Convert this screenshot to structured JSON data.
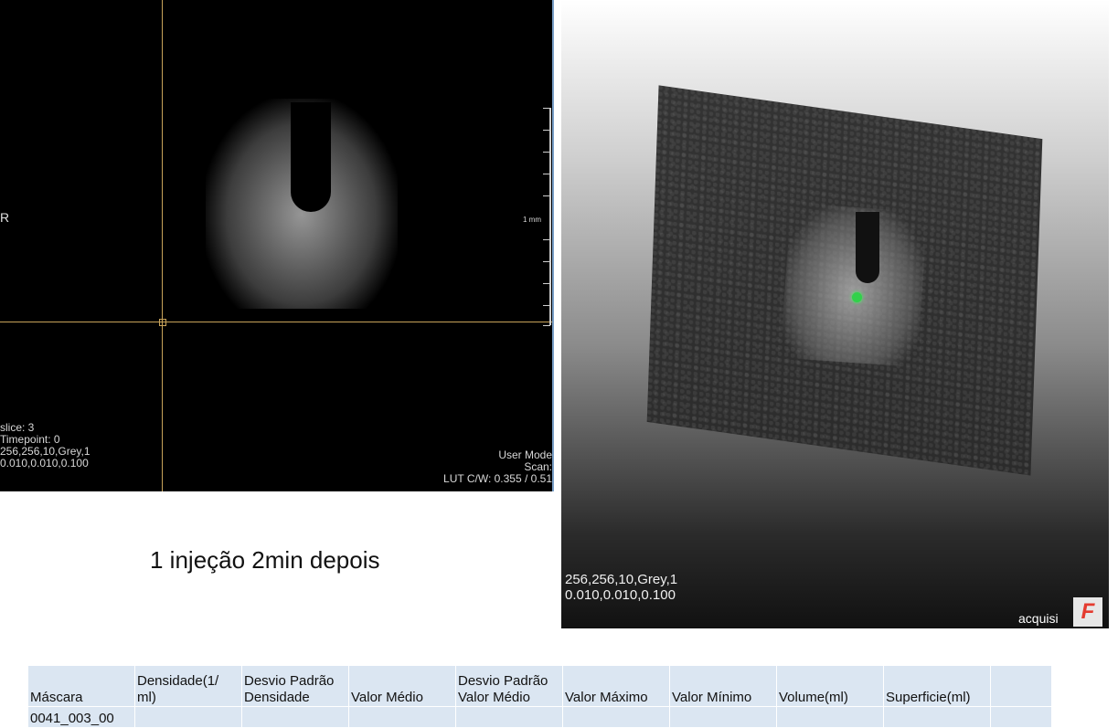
{
  "viewer2d": {
    "orientation_label": "R",
    "overlay_left": {
      "slice": "slice: 3",
      "timepoint": "Timepoint: 0",
      "dims": "256,256,10,Grey,1",
      "spacing": "0.010,0.010,0.100"
    },
    "overlay_right": {
      "mode": "User Mode",
      "scan": "Scan:",
      "lut": "LUT C/W: 0.355 / 0.51"
    },
    "scale_label": "1 mm"
  },
  "viewer3d": {
    "dims": "256,256,10,Grey,1",
    "spacing": "0.010,0.010,0.100",
    "acq_text": "acquisi",
    "logo_letter": "F",
    "marker_color": "#31d14a"
  },
  "caption": "1 injeção 2min depois",
  "table": {
    "headers": [
      "Máscara",
      "Densidade(1/ ml)",
      "Desvio Padrão Densidade",
      "Valor Médio",
      "Desvio Padrão Valor Médio",
      "Valor Máximo",
      "Valor Mínimo",
      "Volume(ml)",
      "Superficie(ml)",
      ""
    ],
    "rows": [
      [
        "0041_003_00",
        "",
        "",
        "",
        "",
        "",
        "",
        "",
        "",
        ""
      ]
    ]
  }
}
